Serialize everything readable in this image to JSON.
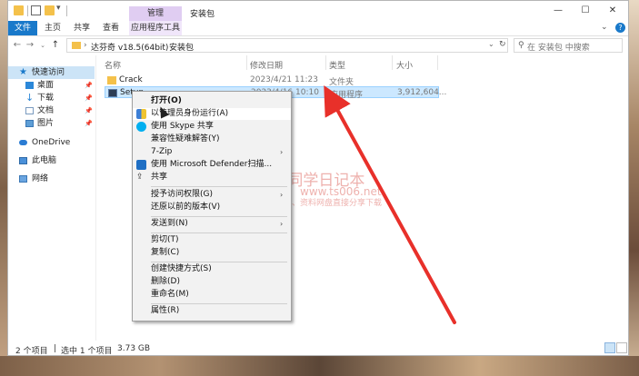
{
  "window": {
    "title": "安装包",
    "manage_tab": "管理",
    "ribbon_tabs": [
      "文件",
      "主页",
      "共享",
      "查看",
      "应用程序工具"
    ],
    "minimize": "—",
    "maximize": "☐",
    "close": "✕",
    "help": "?"
  },
  "address": {
    "crumbs": [
      "达芬奇 v18.5(64bit)",
      "安装包"
    ],
    "separator": "›",
    "search_placeholder": "在 安装包 中搜索"
  },
  "nav": {
    "items": [
      {
        "label": "快速访问",
        "icon": "star-icon",
        "pinned": false
      },
      {
        "label": "桌面",
        "icon": "desktop-icon",
        "pinned": true
      },
      {
        "label": "下载",
        "icon": "download-icon",
        "pinned": true
      },
      {
        "label": "文档",
        "icon": "document-icon",
        "pinned": true
      },
      {
        "label": "图片",
        "icon": "picture-icon",
        "pinned": true
      },
      {
        "label": "OneDrive",
        "icon": "cloud-icon",
        "pinned": false
      },
      {
        "label": "此电脑",
        "icon": "computer-icon",
        "pinned": false
      },
      {
        "label": "网络",
        "icon": "network-icon",
        "pinned": false
      }
    ]
  },
  "columns": {
    "name": "名称",
    "modified": "修改日期",
    "type": "类型",
    "size": "大小"
  },
  "files": [
    {
      "name": "Crack",
      "modified": "2023/4/21 11:23",
      "type": "文件夹",
      "size": ""
    },
    {
      "name": "Setup",
      "modified": "2023/4/16 10:10",
      "type": "应用程序",
      "size": "3,912,604..."
    }
  ],
  "context_menu": {
    "items": [
      {
        "label": "打开(O)",
        "bold": true
      },
      {
        "label": "以管理员身份运行(A)",
        "icon": "uac-shield-icon"
      },
      {
        "label": "使用 Skype 共享",
        "icon": "skype-icon"
      },
      {
        "label": "兼容性疑难解答(Y)"
      },
      {
        "label": "7-Zip",
        "submenu": true
      },
      {
        "label": "使用 Microsoft Defender扫描...",
        "icon": "defender-icon"
      },
      {
        "label": "共享",
        "icon": "share-icon"
      },
      {
        "label": "授予访问权限(G)",
        "submenu": true
      },
      {
        "label": "还原以前的版本(V)"
      },
      {
        "label": "发送到(N)",
        "submenu": true
      },
      {
        "label": "剪切(T)"
      },
      {
        "label": "复制(C)"
      },
      {
        "label": "创建快捷方式(S)"
      },
      {
        "label": "删除(D)"
      },
      {
        "label": "重命名(M)"
      },
      {
        "label": "属性(R)"
      }
    ]
  },
  "status": {
    "count": "2 个项目",
    "selected": "选中 1 个项目",
    "size": "3.73 GB"
  },
  "watermark": {
    "title": "T同学日记本",
    "url": "www.ts006.net",
    "slogan": "软件、资源、资料网盘直接分享下载"
  },
  "colors": {
    "accent": "#1979ca",
    "manage_tab": "#e0cdf2",
    "selection": "#cce8ff",
    "arrow": "#e8302a"
  }
}
